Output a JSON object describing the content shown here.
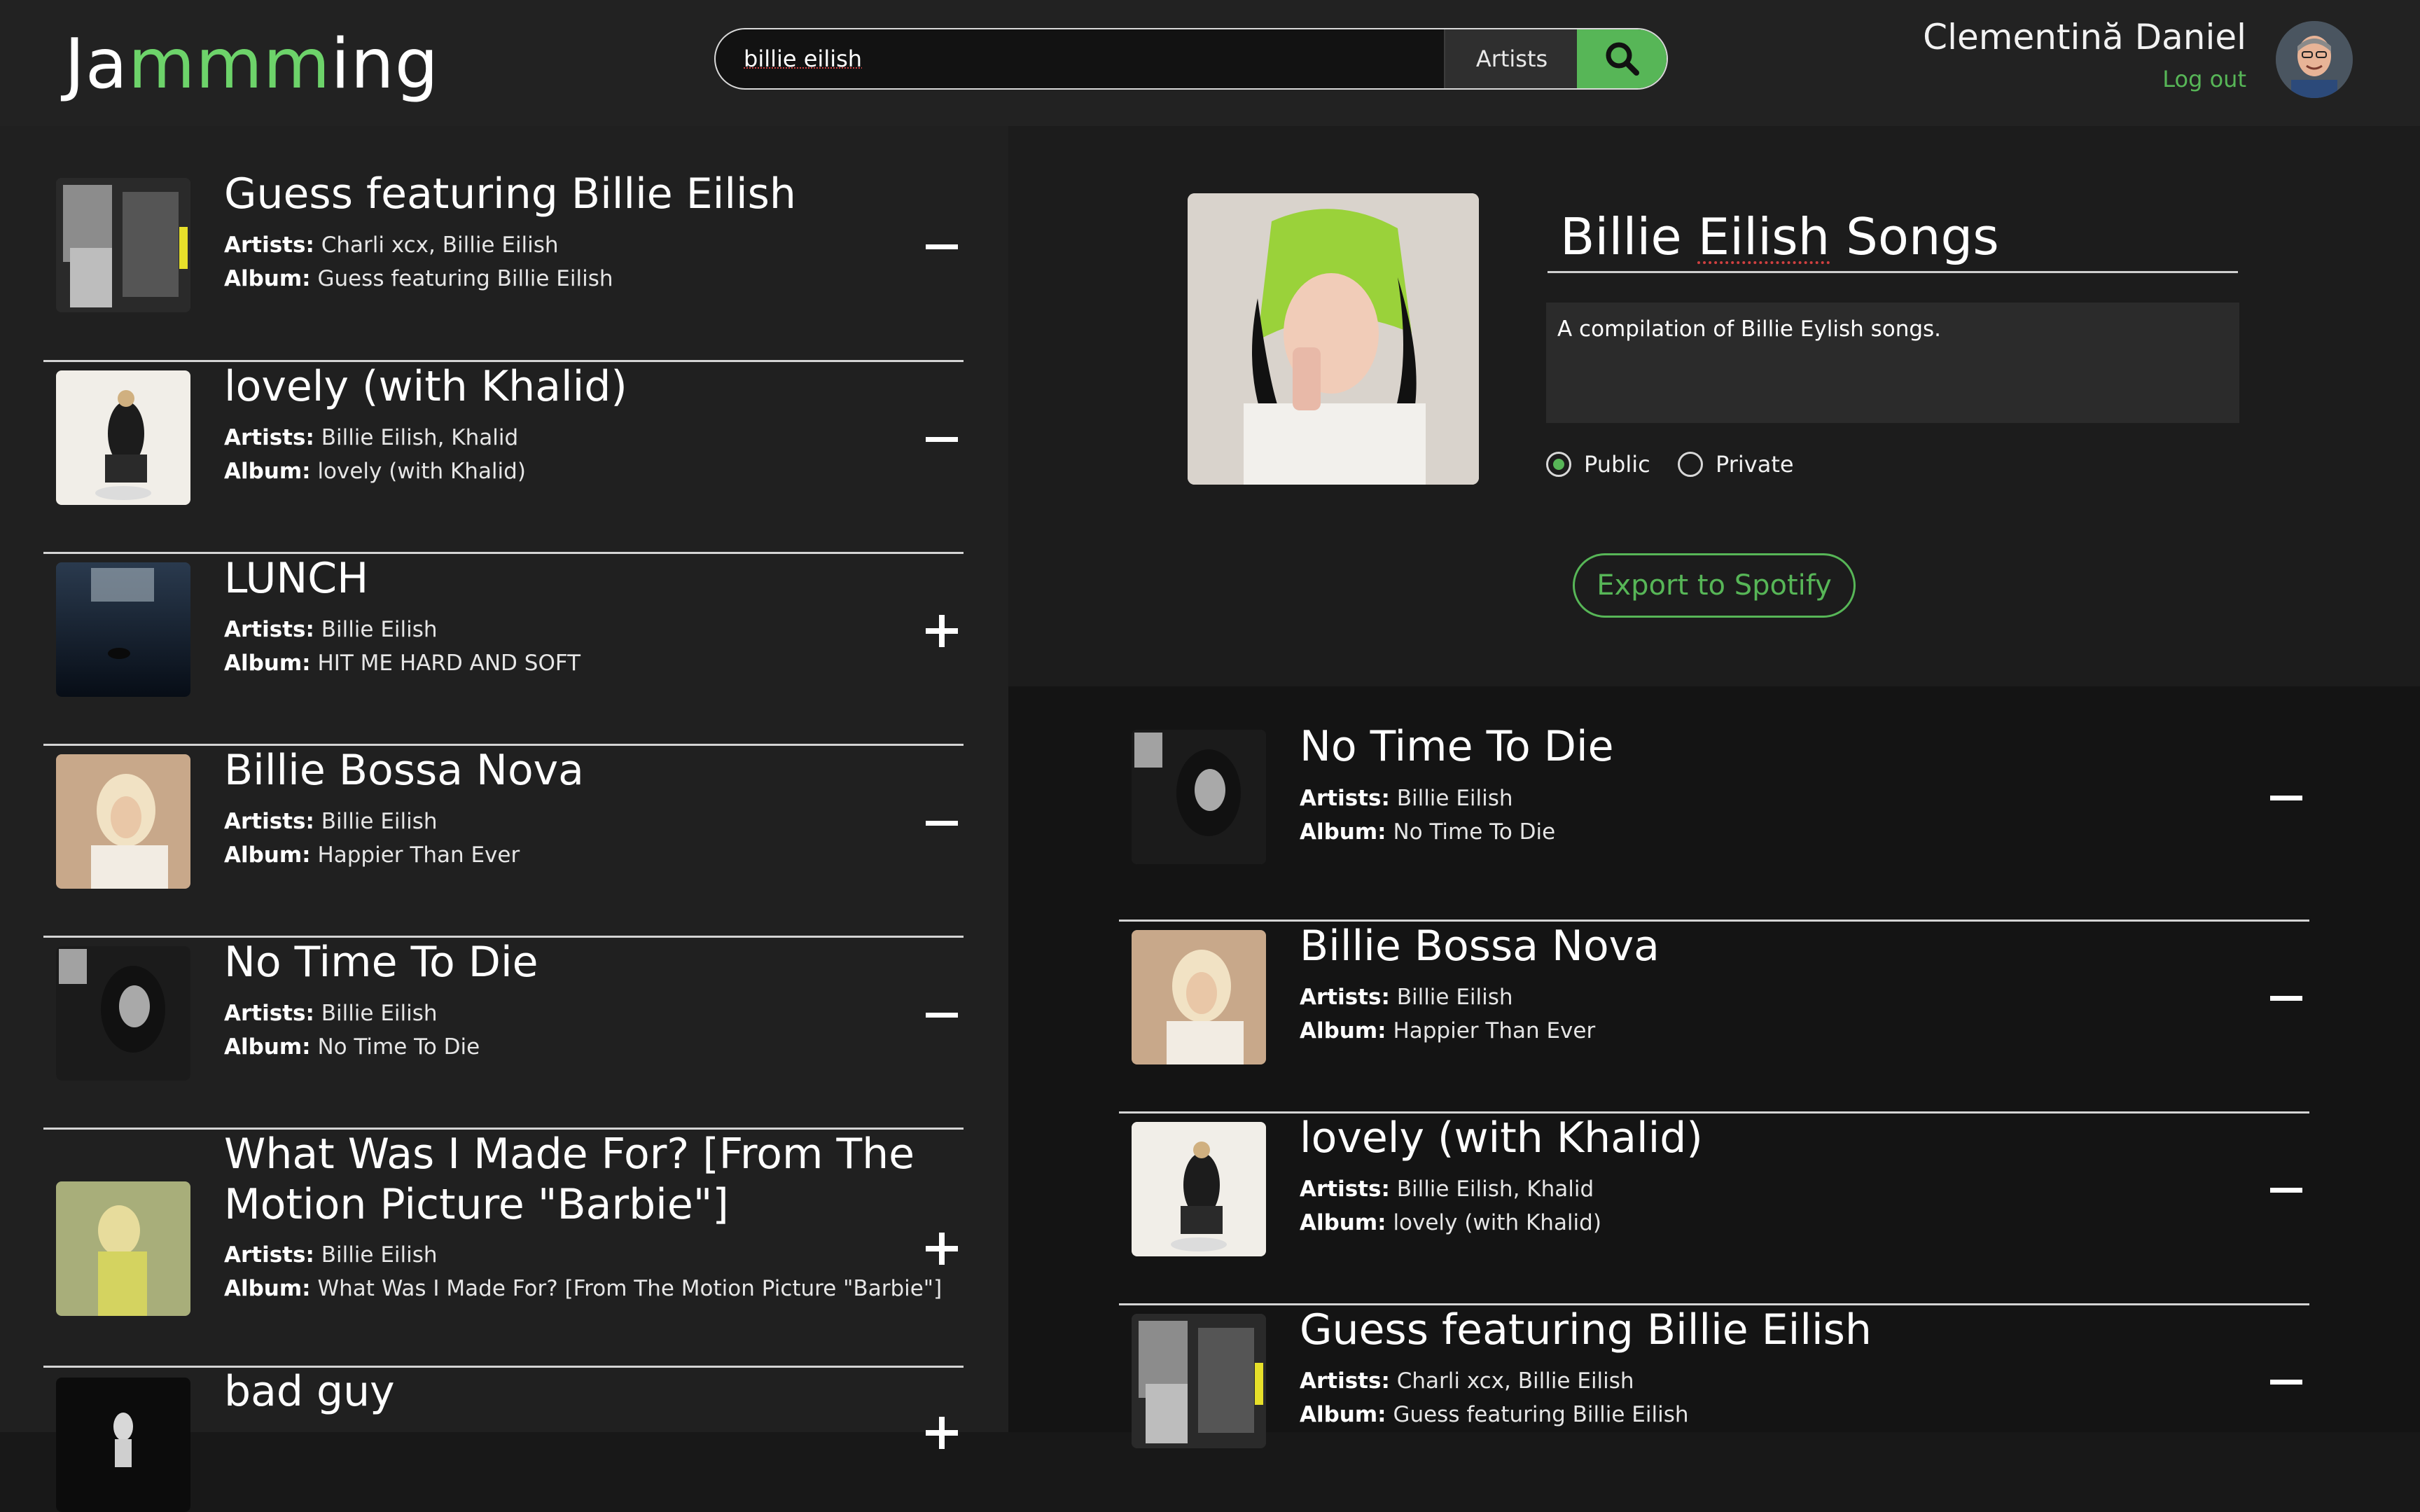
{
  "app": {
    "logo_left": "Ja",
    "logo_mid": "mmm",
    "logo_right": "ing"
  },
  "search": {
    "value": "billie eilish",
    "type": "Artists",
    "button_icon": "search-icon"
  },
  "user": {
    "name": "Clementină Daniel",
    "logout": "Log out"
  },
  "labels": {
    "artists": "Artists:",
    "album": "Album:"
  },
  "colors": {
    "accent": "#57b657",
    "background": "#181818",
    "panel": "#202020"
  },
  "results": [
    {
      "title": "Guess featuring Billie Eilish",
      "artists": "Charli xcx, Billie Eilish",
      "album": "Guess featuring Billie Eilish",
      "action": "−",
      "action_icon": "minus-icon"
    },
    {
      "title": "lovely (with Khalid)",
      "artists": "Billie Eilish, Khalid",
      "album": "lovely (with Khalid)",
      "action": "−",
      "action_icon": "minus-icon"
    },
    {
      "title": "LUNCH",
      "artists": "Billie Eilish",
      "album": "HIT ME HARD AND SOFT",
      "action": "+",
      "action_icon": "plus-icon"
    },
    {
      "title": "Billie Bossa Nova",
      "artists": "Billie Eilish",
      "album": "Happier Than Ever",
      "action": "−",
      "action_icon": "minus-icon"
    },
    {
      "title": "No Time To Die",
      "artists": "Billie Eilish",
      "album": "No Time To Die",
      "action": "−",
      "action_icon": "minus-icon"
    },
    {
      "title_line1": "What Was I Made For? [From The",
      "title_line2": "Motion Picture \"Barbie\"]",
      "artists": "Billie Eilish",
      "album": "What Was I Made For? [From The Motion Picture \"Barbie\"]",
      "action": "+",
      "action_icon": "plus-icon"
    },
    {
      "title": "bad guy",
      "action": "+",
      "action_icon": "plus-icon"
    }
  ],
  "playlist": {
    "name_word1": "Billie",
    "name_word2": "Eilish",
    "name_word3": "Songs",
    "description": "A compilation of Billie Eylish songs.",
    "visibility_options": [
      "Public",
      "Private"
    ],
    "selected_visibility": "Public",
    "export_label": "Export to Spotify",
    "tracks": [
      {
        "title": "No Time To Die",
        "artists": "Billie Eilish",
        "album": "No Time To Die",
        "action": "−",
        "action_icon": "minus-icon"
      },
      {
        "title": "Billie Bossa Nova",
        "artists": "Billie Eilish",
        "album": "Happier Than Ever",
        "action": "−",
        "action_icon": "minus-icon"
      },
      {
        "title": "lovely (with Khalid)",
        "artists": "Billie Eilish, Khalid",
        "album": "lovely (with Khalid)",
        "action": "−",
        "action_icon": "minus-icon"
      },
      {
        "title": "Guess featuring Billie Eilish",
        "artists": "Charli xcx, Billie Eilish",
        "album": "Guess featuring Billie Eilish",
        "action": "−",
        "action_icon": "minus-icon"
      }
    ]
  }
}
